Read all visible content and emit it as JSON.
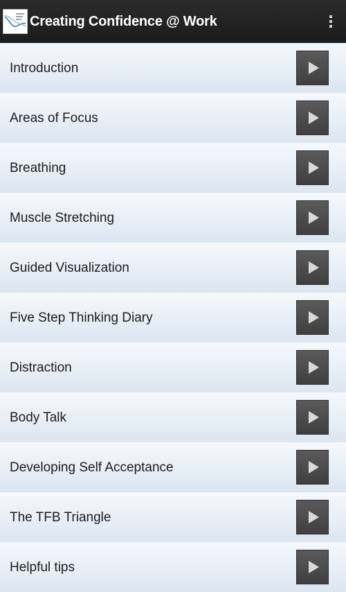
{
  "header": {
    "title": "Creating Confidence @ Work",
    "app_icon": "app-logo-icon",
    "menu_icon": "overflow-menu-icon"
  },
  "list": {
    "items": [
      {
        "label": "Introduction"
      },
      {
        "label": "Areas of Focus"
      },
      {
        "label": "Breathing"
      },
      {
        "label": "Muscle Stretching"
      },
      {
        "label": "Guided Visualization"
      },
      {
        "label": "Five Step Thinking Diary"
      },
      {
        "label": "Distraction"
      },
      {
        "label": "Body Talk"
      },
      {
        "label": "Developing Self Acceptance"
      },
      {
        "label": "The TFB Triangle"
      },
      {
        "label": "Helpful tips"
      }
    ],
    "action_icon": "play-icon"
  },
  "colors": {
    "action_bar": "#1f1f1f",
    "list_bg_light": "#f5f8fc",
    "list_bg_dark": "#dbe5f0",
    "play_button": "#4a4a4a"
  }
}
